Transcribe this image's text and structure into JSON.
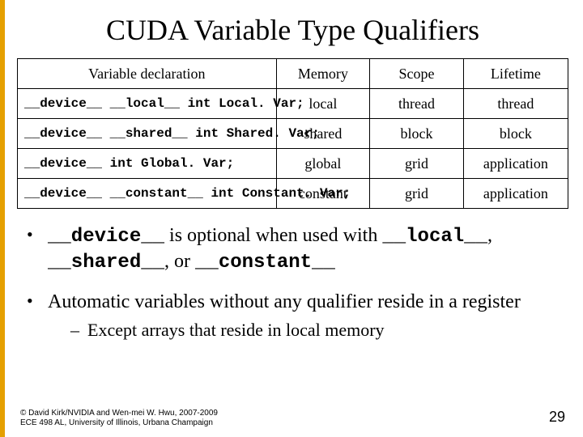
{
  "title": "CUDA Variable Type Qualifiers",
  "headers": {
    "decl": "Variable declaration",
    "memory": "Memory",
    "scope": "Scope",
    "lifetime": "Lifetime"
  },
  "rows": [
    {
      "decl": "__device__ __local__     int Local. Var;",
      "memory": "local",
      "scope": "thread",
      "lifetime": "thread"
    },
    {
      "decl": "__device__ __shared__    int Shared. Var;",
      "memory": "shared",
      "scope": "block",
      "lifetime": "block"
    },
    {
      "decl": "__device__               int Global. Var;",
      "memory": "global",
      "scope": "grid",
      "lifetime": "application"
    },
    {
      "decl": "__device__ __constant__  int Constant. Var;",
      "memory": "constant",
      "scope": "grid",
      "lifetime": "application"
    }
  ],
  "bullet1": {
    "p1": "__device__",
    "p2": " is optional when used with ",
    "p3": "__local__",
    "p4": ", ",
    "p5": "__shared__",
    "p6": ", or ",
    "p7": "__constant__"
  },
  "bullet2": "Automatic variables without any qualifier reside in a register",
  "sub1": "Except arrays that reside in local memory",
  "footer1": "© David Kirk/NVIDIA and Wen-mei W. Hwu, 2007-2009",
  "footer2": "ECE 498 AL, University of Illinois, Urbana Champaign",
  "page": "29"
}
